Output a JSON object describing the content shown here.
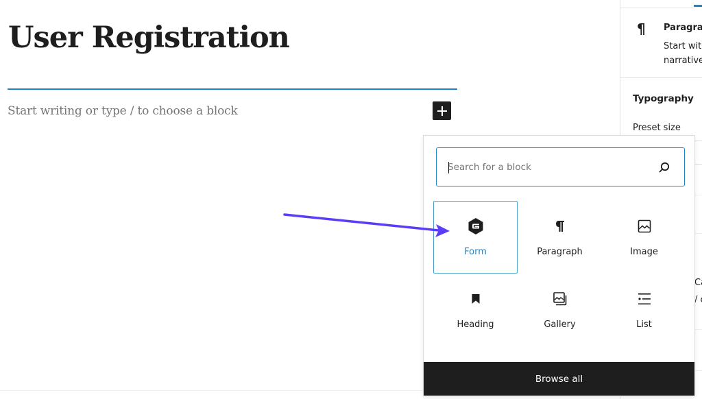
{
  "editor": {
    "title": "User Registration",
    "placeholder": "Start writing or type / to choose a block",
    "inserter_toggle_icon": "plus-icon"
  },
  "sidebar": {
    "block_card": {
      "icon": "paragraph-icon",
      "icon_glyph": "¶",
      "title": "Paragraph",
      "description_line1": "Start with",
      "description_line2": "narrative"
    },
    "typography_label": "Typography",
    "preset_size_label": "Preset size",
    "truncated_text_1": "Ca",
    "truncated_text_2": "/ c"
  },
  "inserter": {
    "search": {
      "placeholder": "Search for a block",
      "value": ""
    },
    "blocks": [
      {
        "label": "Form",
        "icon": "form-icon",
        "selected": true
      },
      {
        "label": "Paragraph",
        "icon": "paragraph-icon",
        "selected": false
      },
      {
        "label": "Image",
        "icon": "image-icon",
        "selected": false
      },
      {
        "label": "Heading",
        "icon": "heading-icon",
        "selected": false
      },
      {
        "label": "Gallery",
        "icon": "gallery-icon",
        "selected": false
      },
      {
        "label": "List",
        "icon": "list-icon",
        "selected": false
      }
    ],
    "browse_all_label": "Browse all"
  },
  "annotation": {
    "type": "arrow",
    "color": "#5b3df5",
    "points_to": "Form"
  },
  "colors": {
    "accent": "#1e84c6",
    "dark": "#1e1e1e",
    "selected_border": "#4aa3c8"
  }
}
